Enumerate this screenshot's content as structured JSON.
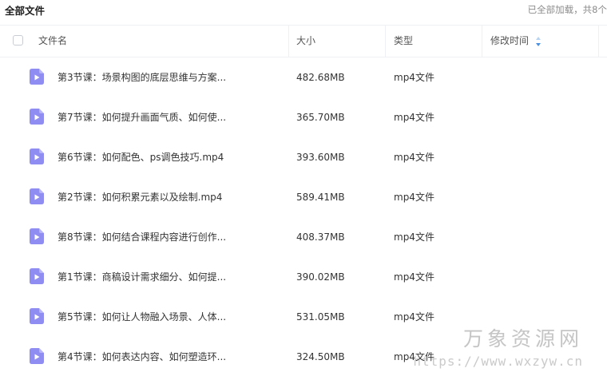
{
  "breadcrumb": {
    "label": "全部文件"
  },
  "status": {
    "text": "已全部加载，共8个"
  },
  "table": {
    "headers": {
      "name": "文件名",
      "size": "大小",
      "type": "类型",
      "modified": "修改时间"
    },
    "rows": [
      {
        "name": "第3节课：场景构图的底层思维与方案...",
        "size": "482.68MB",
        "type": "mp4文件"
      },
      {
        "name": "第7节课：如何提升画面气质、如何使...",
        "size": "365.70MB",
        "type": "mp4文件"
      },
      {
        "name": "第6节课：如何配色、ps调色技巧.mp4",
        "size": "393.60MB",
        "type": "mp4文件"
      },
      {
        "name": "第2节课：如何积累元素以及绘制.mp4",
        "size": "589.41MB",
        "type": "mp4文件"
      },
      {
        "name": "第8节课：如何结合课程内容进行创作...",
        "size": "408.37MB",
        "type": "mp4文件"
      },
      {
        "name": "第1节课：商稿设计需求细分、如何提...",
        "size": "390.02MB",
        "type": "mp4文件"
      },
      {
        "name": "第5节课：如何让人物融入场景、人体...",
        "size": "531.05MB",
        "type": "mp4文件"
      },
      {
        "name": "第4节课：如何表达内容、如何塑造环...",
        "size": "324.50MB",
        "type": "mp4文件"
      }
    ]
  },
  "icons": {
    "file": "video-file-icon",
    "sort": "sort-icon",
    "checkbox": "checkbox"
  },
  "colors": {
    "file_icon": "#8f8cf2",
    "sort_icon": "#4a90e2"
  },
  "watermark": {
    "title": "万象资源网",
    "url": "https://www.wxzyw.cn"
  }
}
